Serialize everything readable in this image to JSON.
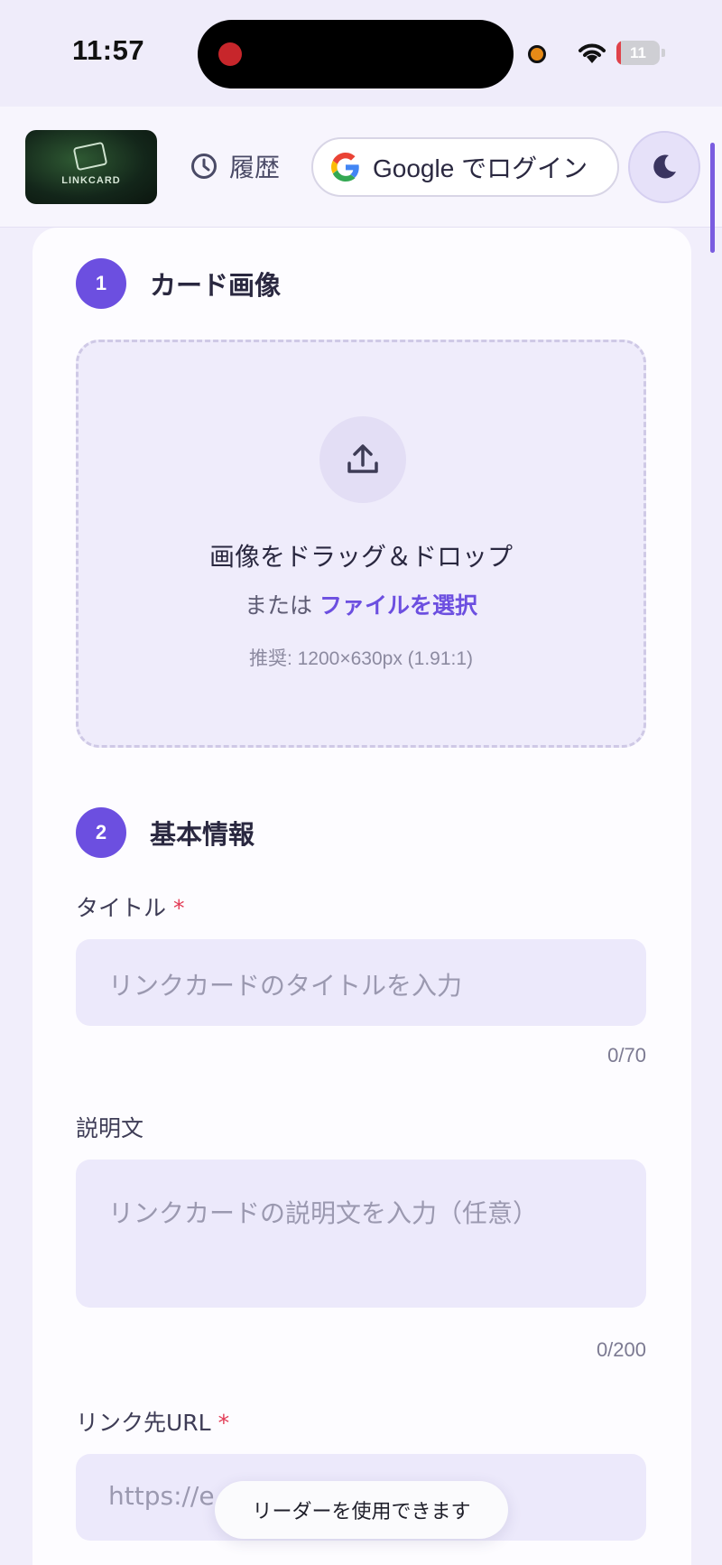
{
  "status_bar": {
    "time": "11:57",
    "battery_level": "11",
    "battery_fraction": 0.11,
    "battery_color": "#e0424a"
  },
  "header": {
    "logo_text": "LINKCARD",
    "history_label": "履歴",
    "history_icon": "clock-icon",
    "login_label": "Google でログイン",
    "login_icon": "google-icon",
    "theme_icon": "moon-icon"
  },
  "section1": {
    "step": "1",
    "title": "カード画像",
    "upload_icon": "upload-icon",
    "dropzone_title": "画像をドラッグ＆ドロップ",
    "dropzone_or": "または",
    "dropzone_link": "ファイルを選択",
    "dropzone_hint": "推奨: 1200×630px (1.91:1)"
  },
  "section2": {
    "step": "2",
    "title": "基本情報",
    "title_field": {
      "label": "タイトル",
      "required_mark": "*",
      "placeholder": "リンクカードのタイトルを入力",
      "counter": "0/70"
    },
    "description_field": {
      "label": "説明文",
      "placeholder": "リンクカードの説明文を入力（任意）",
      "counter": "0/200"
    },
    "url_field": {
      "label": "リンク先URL",
      "required_mark": "*",
      "placeholder": "https://e"
    }
  },
  "toast": {
    "text": "リーダーを使用できます"
  },
  "colors": {
    "accent": "#6c4fe0",
    "required": "#e23b55",
    "background": "#f1eefb"
  }
}
